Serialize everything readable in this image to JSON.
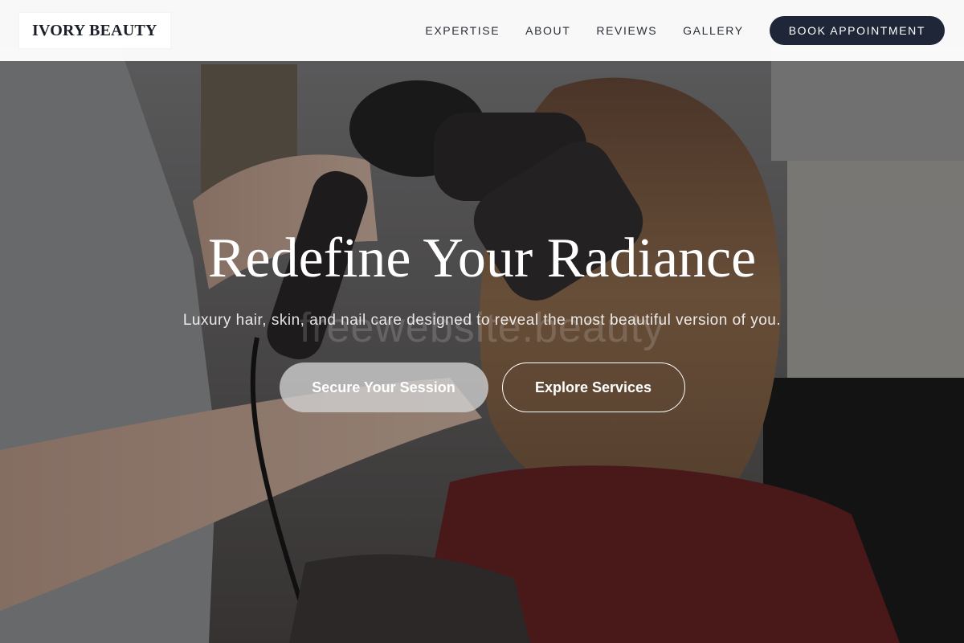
{
  "brand": {
    "logo_text": "IVORY BEAUTY"
  },
  "nav": {
    "items": [
      {
        "label": "EXPERTISE"
      },
      {
        "label": "ABOUT"
      },
      {
        "label": "REVIEWS"
      },
      {
        "label": "GALLERY"
      }
    ],
    "cta_label": "BOOK APPOINTMENT"
  },
  "hero": {
    "headline": "Redefine Your Radiance",
    "subline": "Luxury hair, skin, and nail care designed to reveal the most beautiful version of you.",
    "watermark": "freewebsite.beauty",
    "primary_button": "Secure Your Session",
    "secondary_button": "Explore Services"
  },
  "colors": {
    "nav_button_bg": "#1e2638",
    "logo_text": "#1b1f2a",
    "header_bg": "#ffffff",
    "text_on_hero": "#ffffff"
  }
}
